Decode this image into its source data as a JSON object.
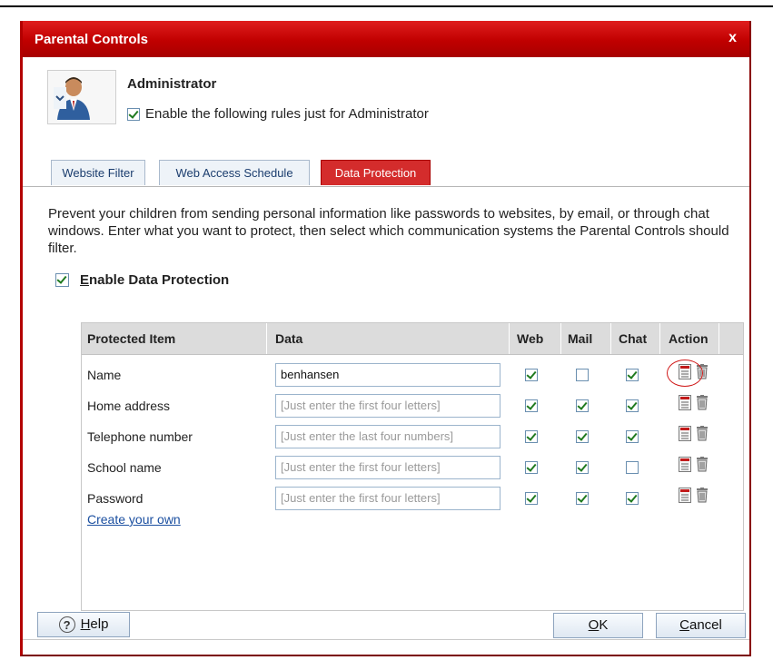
{
  "window": {
    "title": "Parental Controls",
    "close_label": "x"
  },
  "user": {
    "name": "Administrator",
    "enable_rules_label": "Enable the following rules just for Administrator",
    "enable_rules_checked": true
  },
  "tabs": [
    {
      "label": "Website Filter",
      "active": false
    },
    {
      "label": "Web Access Schedule",
      "active": false
    },
    {
      "label": "Data Protection",
      "active": true
    }
  ],
  "description": "Prevent your children from sending personal information like passwords to websites, by email, or through chat windows. Enter what you want to protect, then select which communication systems the Parental Controls should filter.",
  "enable_dp": {
    "label": "Enable Data Protection",
    "checked": true
  },
  "table": {
    "columns": [
      "Protected Item",
      "Data",
      "Web",
      "Mail",
      "Chat",
      "Action"
    ],
    "rows": [
      {
        "item": "Name",
        "data": "benhansen",
        "placeholder": "",
        "web": true,
        "mail": false,
        "chat": true,
        "highlighted": true
      },
      {
        "item": "Home address",
        "data": "",
        "placeholder": "[Just enter the first four letters]",
        "web": true,
        "mail": true,
        "chat": true,
        "highlighted": false
      },
      {
        "item": "Telephone number",
        "data": "",
        "placeholder": "[Just enter the last four numbers]",
        "web": true,
        "mail": true,
        "chat": true,
        "highlighted": false
      },
      {
        "item": "School name",
        "data": "",
        "placeholder": "[Just enter the first four letters]",
        "web": true,
        "mail": true,
        "chat": false,
        "highlighted": false
      },
      {
        "item": "Password",
        "data": "",
        "placeholder": "[Just enter the first four letters]",
        "web": true,
        "mail": true,
        "chat": true,
        "highlighted": false
      }
    ],
    "create_own_label": "Create your own"
  },
  "buttons": {
    "help_u": "H",
    "help_rest": "elp",
    "ok_u": "O",
    "ok_rest": "K",
    "cancel_u": "C",
    "cancel_rest": "ancel"
  },
  "colors": {
    "titlebar": "#c00000",
    "active_tab": "#d42c2c",
    "check": "#1f7a1f",
    "link": "#1b4fa0"
  }
}
